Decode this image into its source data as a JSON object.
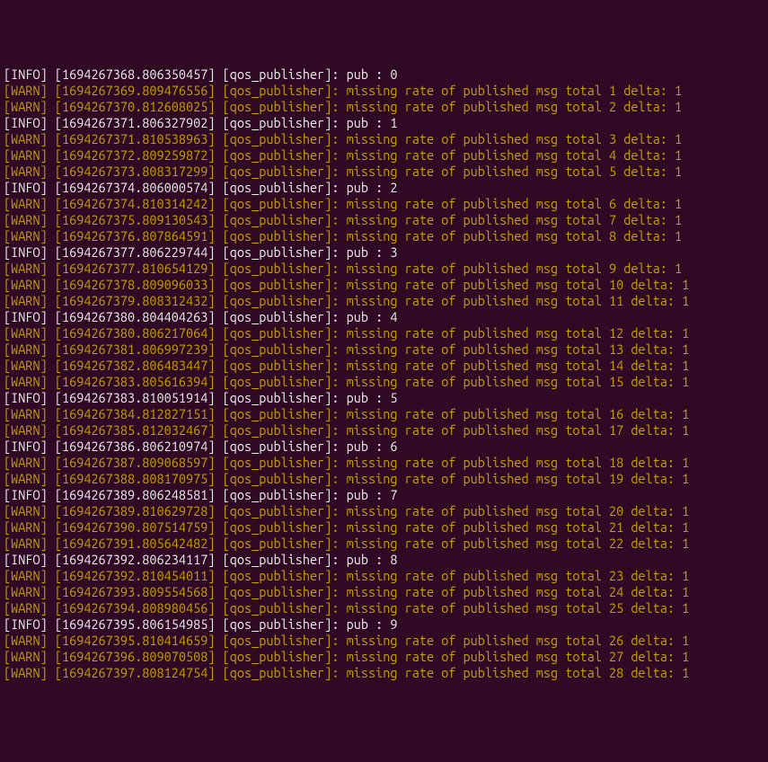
{
  "lines": [
    {
      "level": "INFO",
      "ts": "1694267368.806350457",
      "node": "qos_publisher",
      "msg": "pub : 0"
    },
    {
      "level": "WARN",
      "ts": "1694267369.809476556",
      "node": "qos_publisher",
      "msg": "missing rate of published msg total 1 delta: 1"
    },
    {
      "level": "WARN",
      "ts": "1694267370.812608025",
      "node": "qos_publisher",
      "msg": "missing rate of published msg total 2 delta: 1"
    },
    {
      "level": "INFO",
      "ts": "1694267371.806327902",
      "node": "qos_publisher",
      "msg": "pub : 1"
    },
    {
      "level": "WARN",
      "ts": "1694267371.810538963",
      "node": "qos_publisher",
      "msg": "missing rate of published msg total 3 delta: 1"
    },
    {
      "level": "WARN",
      "ts": "1694267372.809259872",
      "node": "qos_publisher",
      "msg": "missing rate of published msg total 4 delta: 1"
    },
    {
      "level": "WARN",
      "ts": "1694267373.808317299",
      "node": "qos_publisher",
      "msg": "missing rate of published msg total 5 delta: 1"
    },
    {
      "level": "INFO",
      "ts": "1694267374.806000574",
      "node": "qos_publisher",
      "msg": "pub : 2"
    },
    {
      "level": "WARN",
      "ts": "1694267374.810314242",
      "node": "qos_publisher",
      "msg": "missing rate of published msg total 6 delta: 1"
    },
    {
      "level": "WARN",
      "ts": "1694267375.809130543",
      "node": "qos_publisher",
      "msg": "missing rate of published msg total 7 delta: 1"
    },
    {
      "level": "WARN",
      "ts": "1694267376.807864591",
      "node": "qos_publisher",
      "msg": "missing rate of published msg total 8 delta: 1"
    },
    {
      "level": "INFO",
      "ts": "1694267377.806229744",
      "node": "qos_publisher",
      "msg": "pub : 3"
    },
    {
      "level": "WARN",
      "ts": "1694267377.810654129",
      "node": "qos_publisher",
      "msg": "missing rate of published msg total 9 delta: 1"
    },
    {
      "level": "WARN",
      "ts": "1694267378.809096033",
      "node": "qos_publisher",
      "msg": "missing rate of published msg total 10 delta: 1"
    },
    {
      "level": "WARN",
      "ts": "1694267379.808312432",
      "node": "qos_publisher",
      "msg": "missing rate of published msg total 11 delta: 1"
    },
    {
      "level": "INFO",
      "ts": "1694267380.804404263",
      "node": "qos_publisher",
      "msg": "pub : 4"
    },
    {
      "level": "WARN",
      "ts": "1694267380.806217064",
      "node": "qos_publisher",
      "msg": "missing rate of published msg total 12 delta: 1"
    },
    {
      "level": "WARN",
      "ts": "1694267381.806997239",
      "node": "qos_publisher",
      "msg": "missing rate of published msg total 13 delta: 1"
    },
    {
      "level": "WARN",
      "ts": "1694267382.806483447",
      "node": "qos_publisher",
      "msg": "missing rate of published msg total 14 delta: 1"
    },
    {
      "level": "WARN",
      "ts": "1694267383.805616394",
      "node": "qos_publisher",
      "msg": "missing rate of published msg total 15 delta: 1"
    },
    {
      "level": "INFO",
      "ts": "1694267383.810051914",
      "node": "qos_publisher",
      "msg": "pub : 5"
    },
    {
      "level": "WARN",
      "ts": "1694267384.812827151",
      "node": "qos_publisher",
      "msg": "missing rate of published msg total 16 delta: 1"
    },
    {
      "level": "WARN",
      "ts": "1694267385.812032467",
      "node": "qos_publisher",
      "msg": "missing rate of published msg total 17 delta: 1"
    },
    {
      "level": "INFO",
      "ts": "1694267386.806210974",
      "node": "qos_publisher",
      "msg": "pub : 6"
    },
    {
      "level": "WARN",
      "ts": "1694267387.809068597",
      "node": "qos_publisher",
      "msg": "missing rate of published msg total 18 delta: 1"
    },
    {
      "level": "WARN",
      "ts": "1694267388.808170975",
      "node": "qos_publisher",
      "msg": "missing rate of published msg total 19 delta: 1"
    },
    {
      "level": "INFO",
      "ts": "1694267389.806248581",
      "node": "qos_publisher",
      "msg": "pub : 7"
    },
    {
      "level": "WARN",
      "ts": "1694267389.810629728",
      "node": "qos_publisher",
      "msg": "missing rate of published msg total 20 delta: 1"
    },
    {
      "level": "WARN",
      "ts": "1694267390.807514759",
      "node": "qos_publisher",
      "msg": "missing rate of published msg total 21 delta: 1"
    },
    {
      "level": "WARN",
      "ts": "1694267391.805642482",
      "node": "qos_publisher",
      "msg": "missing rate of published msg total 22 delta: 1"
    },
    {
      "level": "INFO",
      "ts": "1694267392.806234117",
      "node": "qos_publisher",
      "msg": "pub : 8"
    },
    {
      "level": "WARN",
      "ts": "1694267392.810454011",
      "node": "qos_publisher",
      "msg": "missing rate of published msg total 23 delta: 1"
    },
    {
      "level": "WARN",
      "ts": "1694267393.809554568",
      "node": "qos_publisher",
      "msg": "missing rate of published msg total 24 delta: 1"
    },
    {
      "level": "WARN",
      "ts": "1694267394.808980456",
      "node": "qos_publisher",
      "msg": "missing rate of published msg total 25 delta: 1"
    },
    {
      "level": "INFO",
      "ts": "1694267395.806154985",
      "node": "qos_publisher",
      "msg": "pub : 9"
    },
    {
      "level": "WARN",
      "ts": "1694267395.810414659",
      "node": "qos_publisher",
      "msg": "missing rate of published msg total 26 delta: 1"
    },
    {
      "level": "WARN",
      "ts": "1694267396.809070508",
      "node": "qos_publisher",
      "msg": "missing rate of published msg total 27 delta: 1"
    },
    {
      "level": "WARN",
      "ts": "1694267397.808124754",
      "node": "qos_publisher",
      "msg": "missing rate of published msg total 28 delta: 1"
    }
  ]
}
